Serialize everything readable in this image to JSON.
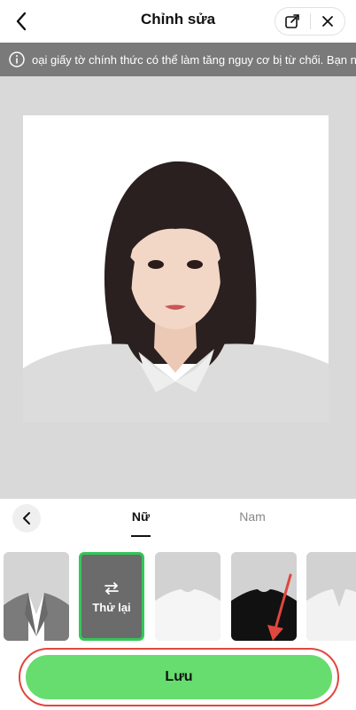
{
  "header": {
    "title": "Chỉnh sửa"
  },
  "notice": {
    "text": "oại giấy tờ chính thức có thể làm tăng nguy cơ bị từ chối. Bạn n"
  },
  "tabs": {
    "female": "Nữ",
    "male": "Nam",
    "active": "female"
  },
  "outfits": {
    "retry_label": "Thử lại",
    "items": [
      "grey-blazer",
      "selected-retry",
      "white-tshirt",
      "black-tshirt",
      "white-vneck"
    ]
  },
  "save_button": {
    "label": "Lưu"
  },
  "colors": {
    "accent_green": "#66dd6e",
    "selected_border": "#34c759",
    "annotation_red": "#e0473e",
    "notice_bg": "#7a7a7a"
  }
}
